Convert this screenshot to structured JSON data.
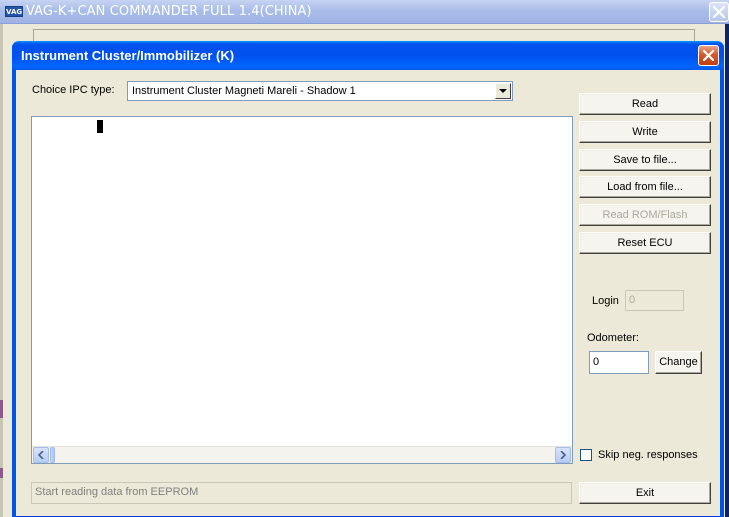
{
  "parent_window": {
    "logo_text": "VAG",
    "title": "VAG-K+CAN COMMANDER FULL 1.4(CHINA)"
  },
  "dialog": {
    "title": "Instrument Cluster/Immobilizer (K)"
  },
  "ipc": {
    "label": "Choice IPC type:",
    "selected": "Instrument Cluster Magneti Mareli - Shadow 1"
  },
  "buttons": {
    "read": "Read",
    "write": "Write",
    "save": "Save to file...",
    "load": "Load from file...",
    "read_rom": "Read ROM/Flash",
    "reset": "Reset ECU",
    "exit": "Exit",
    "change": "Change"
  },
  "login": {
    "label": "Login",
    "value": "0"
  },
  "odometer": {
    "label": "Odometer:",
    "value": "0"
  },
  "skip_neg": {
    "label": "Skip neg. responses",
    "checked": false
  },
  "status": {
    "text": "Start reading data from EEPROM"
  },
  "colors": {
    "titlebar_active": "#0054e3",
    "titlebar_inactive": "#9eb3e3",
    "close_button": "#c13c13",
    "face": "#ECE9D8"
  }
}
